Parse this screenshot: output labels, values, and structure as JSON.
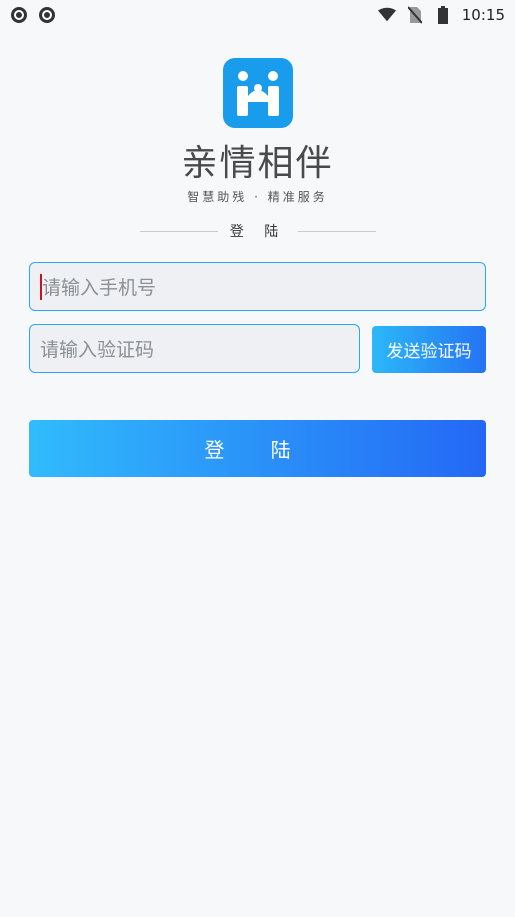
{
  "status_bar": {
    "left_icons": [
      "sync-icon",
      "sync-icon"
    ],
    "right_icons": [
      "wifi-icon",
      "no-sim-icon",
      "battery-icon"
    ],
    "time": "10:15"
  },
  "brand": {
    "logo_icon": "family-logo-icon",
    "logo_color": "#1a9cec",
    "app_name": "亲情相伴",
    "slogan": "智慧助残 · 精准服务"
  },
  "login": {
    "section_label": "登 陆",
    "phone_placeholder": "请输入手机号",
    "code_placeholder": "请输入验证码",
    "send_code_label": "发送验证码",
    "login_label": "登 陆"
  },
  "colors": {
    "accent_border": "#2aa8e8",
    "gradient_start": "#31bbfc",
    "gradient_end": "#2468f5"
  }
}
